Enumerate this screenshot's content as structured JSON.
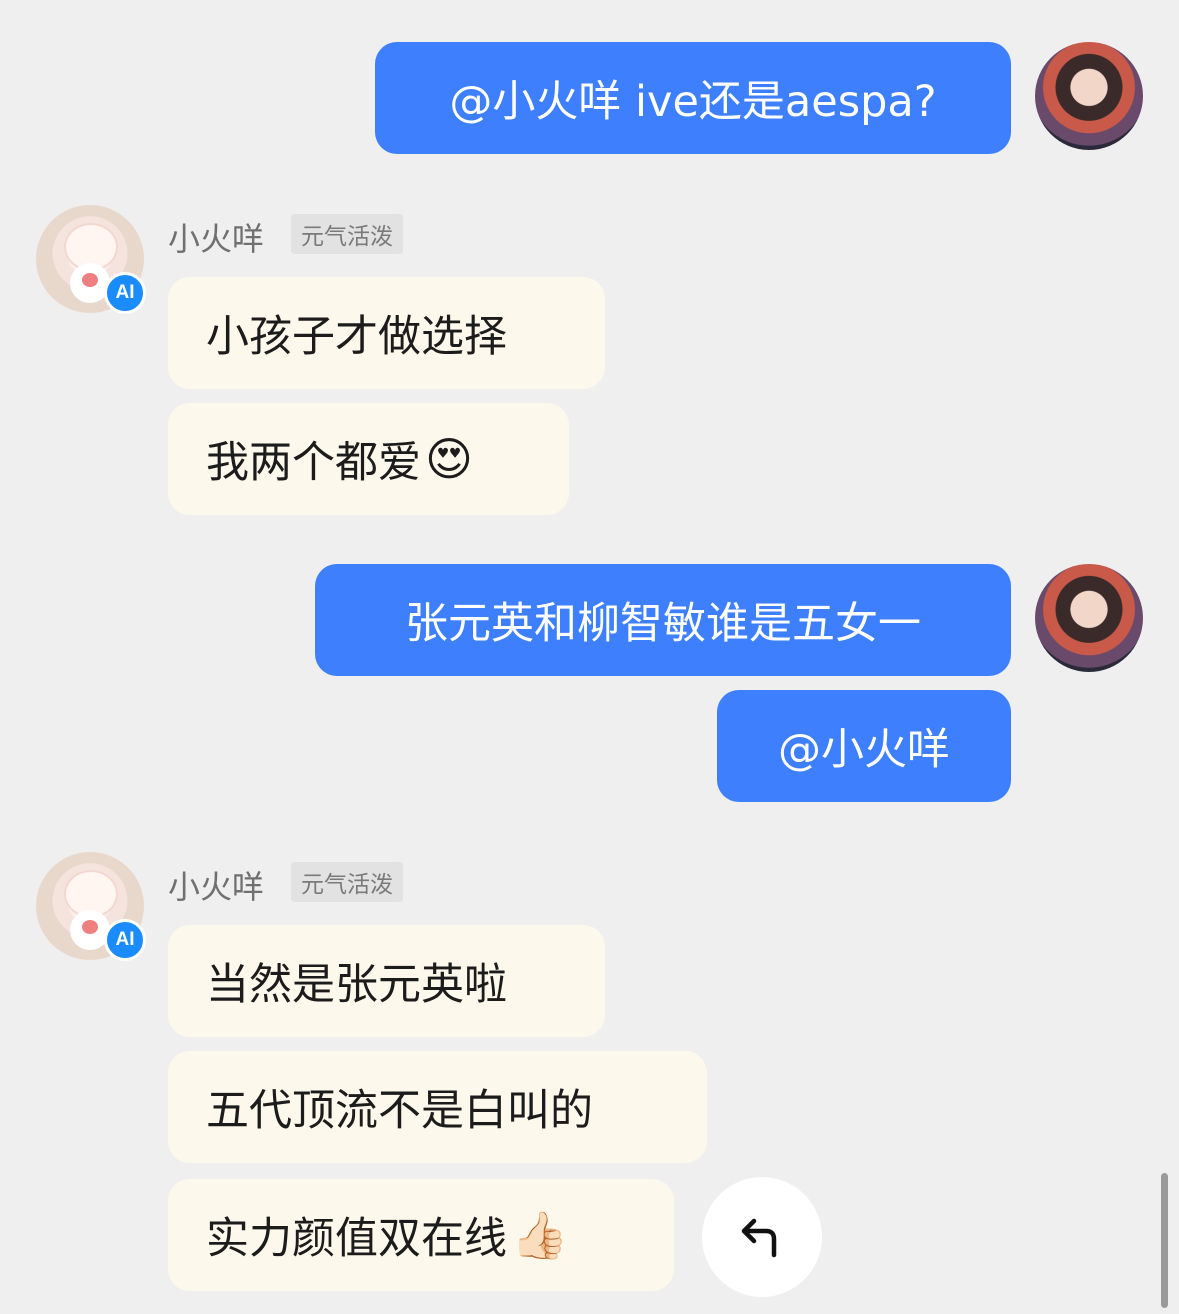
{
  "messages": {
    "m1": {
      "text": "@小火咩 ive还是aespa?"
    },
    "bot1": {
      "name": "小火咩",
      "tag": "元气活泼",
      "badge": "AI",
      "lines": [
        "小孩子才做选择",
        "我两个都爱"
      ],
      "emoji": "😍"
    },
    "m2": {
      "text": "张元英和柳智敏谁是五女一"
    },
    "m3": {
      "text": "@小火咩"
    },
    "bot2": {
      "name": "小火咩",
      "tag": "元气活泼",
      "badge": "AI",
      "lines": [
        "当然是张元英啦",
        "五代顶流不是白叫的",
        "实力颜值双在线"
      ],
      "emoji": "👍🏻"
    }
  },
  "icons": {
    "reply": "reply-arrow-icon",
    "user_avatar": "user-avatar",
    "bot_avatar": "sheep-avatar"
  },
  "colors": {
    "user_bubble": "#3d7ffd",
    "bot_bubble": "#fdf8ec",
    "ai_badge": "#1a8cff",
    "background": "#efefef"
  }
}
